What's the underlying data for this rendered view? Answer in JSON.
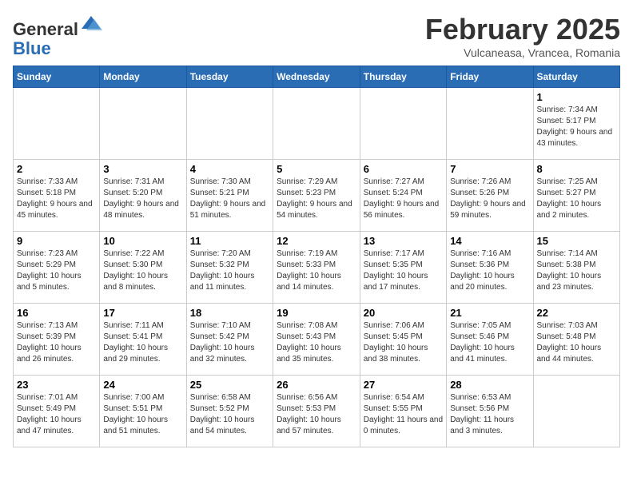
{
  "header": {
    "logo_general": "General",
    "logo_blue": "Blue",
    "month_title": "February 2025",
    "location": "Vulcaneasa, Vrancea, Romania"
  },
  "days_of_week": [
    "Sunday",
    "Monday",
    "Tuesday",
    "Wednesday",
    "Thursday",
    "Friday",
    "Saturday"
  ],
  "weeks": [
    [
      {
        "day": "",
        "info": ""
      },
      {
        "day": "",
        "info": ""
      },
      {
        "day": "",
        "info": ""
      },
      {
        "day": "",
        "info": ""
      },
      {
        "day": "",
        "info": ""
      },
      {
        "day": "",
        "info": ""
      },
      {
        "day": "1",
        "info": "Sunrise: 7:34 AM\nSunset: 5:17 PM\nDaylight: 9 hours and 43 minutes."
      }
    ],
    [
      {
        "day": "2",
        "info": "Sunrise: 7:33 AM\nSunset: 5:18 PM\nDaylight: 9 hours and 45 minutes."
      },
      {
        "day": "3",
        "info": "Sunrise: 7:31 AM\nSunset: 5:20 PM\nDaylight: 9 hours and 48 minutes."
      },
      {
        "day": "4",
        "info": "Sunrise: 7:30 AM\nSunset: 5:21 PM\nDaylight: 9 hours and 51 minutes."
      },
      {
        "day": "5",
        "info": "Sunrise: 7:29 AM\nSunset: 5:23 PM\nDaylight: 9 hours and 54 minutes."
      },
      {
        "day": "6",
        "info": "Sunrise: 7:27 AM\nSunset: 5:24 PM\nDaylight: 9 hours and 56 minutes."
      },
      {
        "day": "7",
        "info": "Sunrise: 7:26 AM\nSunset: 5:26 PM\nDaylight: 9 hours and 59 minutes."
      },
      {
        "day": "8",
        "info": "Sunrise: 7:25 AM\nSunset: 5:27 PM\nDaylight: 10 hours and 2 minutes."
      }
    ],
    [
      {
        "day": "9",
        "info": "Sunrise: 7:23 AM\nSunset: 5:29 PM\nDaylight: 10 hours and 5 minutes."
      },
      {
        "day": "10",
        "info": "Sunrise: 7:22 AM\nSunset: 5:30 PM\nDaylight: 10 hours and 8 minutes."
      },
      {
        "day": "11",
        "info": "Sunrise: 7:20 AM\nSunset: 5:32 PM\nDaylight: 10 hours and 11 minutes."
      },
      {
        "day": "12",
        "info": "Sunrise: 7:19 AM\nSunset: 5:33 PM\nDaylight: 10 hours and 14 minutes."
      },
      {
        "day": "13",
        "info": "Sunrise: 7:17 AM\nSunset: 5:35 PM\nDaylight: 10 hours and 17 minutes."
      },
      {
        "day": "14",
        "info": "Sunrise: 7:16 AM\nSunset: 5:36 PM\nDaylight: 10 hours and 20 minutes."
      },
      {
        "day": "15",
        "info": "Sunrise: 7:14 AM\nSunset: 5:38 PM\nDaylight: 10 hours and 23 minutes."
      }
    ],
    [
      {
        "day": "16",
        "info": "Sunrise: 7:13 AM\nSunset: 5:39 PM\nDaylight: 10 hours and 26 minutes."
      },
      {
        "day": "17",
        "info": "Sunrise: 7:11 AM\nSunset: 5:41 PM\nDaylight: 10 hours and 29 minutes."
      },
      {
        "day": "18",
        "info": "Sunrise: 7:10 AM\nSunset: 5:42 PM\nDaylight: 10 hours and 32 minutes."
      },
      {
        "day": "19",
        "info": "Sunrise: 7:08 AM\nSunset: 5:43 PM\nDaylight: 10 hours and 35 minutes."
      },
      {
        "day": "20",
        "info": "Sunrise: 7:06 AM\nSunset: 5:45 PM\nDaylight: 10 hours and 38 minutes."
      },
      {
        "day": "21",
        "info": "Sunrise: 7:05 AM\nSunset: 5:46 PM\nDaylight: 10 hours and 41 minutes."
      },
      {
        "day": "22",
        "info": "Sunrise: 7:03 AM\nSunset: 5:48 PM\nDaylight: 10 hours and 44 minutes."
      }
    ],
    [
      {
        "day": "23",
        "info": "Sunrise: 7:01 AM\nSunset: 5:49 PM\nDaylight: 10 hours and 47 minutes."
      },
      {
        "day": "24",
        "info": "Sunrise: 7:00 AM\nSunset: 5:51 PM\nDaylight: 10 hours and 51 minutes."
      },
      {
        "day": "25",
        "info": "Sunrise: 6:58 AM\nSunset: 5:52 PM\nDaylight: 10 hours and 54 minutes."
      },
      {
        "day": "26",
        "info": "Sunrise: 6:56 AM\nSunset: 5:53 PM\nDaylight: 10 hours and 57 minutes."
      },
      {
        "day": "27",
        "info": "Sunrise: 6:54 AM\nSunset: 5:55 PM\nDaylight: 11 hours and 0 minutes."
      },
      {
        "day": "28",
        "info": "Sunrise: 6:53 AM\nSunset: 5:56 PM\nDaylight: 11 hours and 3 minutes."
      },
      {
        "day": "",
        "info": ""
      }
    ]
  ]
}
